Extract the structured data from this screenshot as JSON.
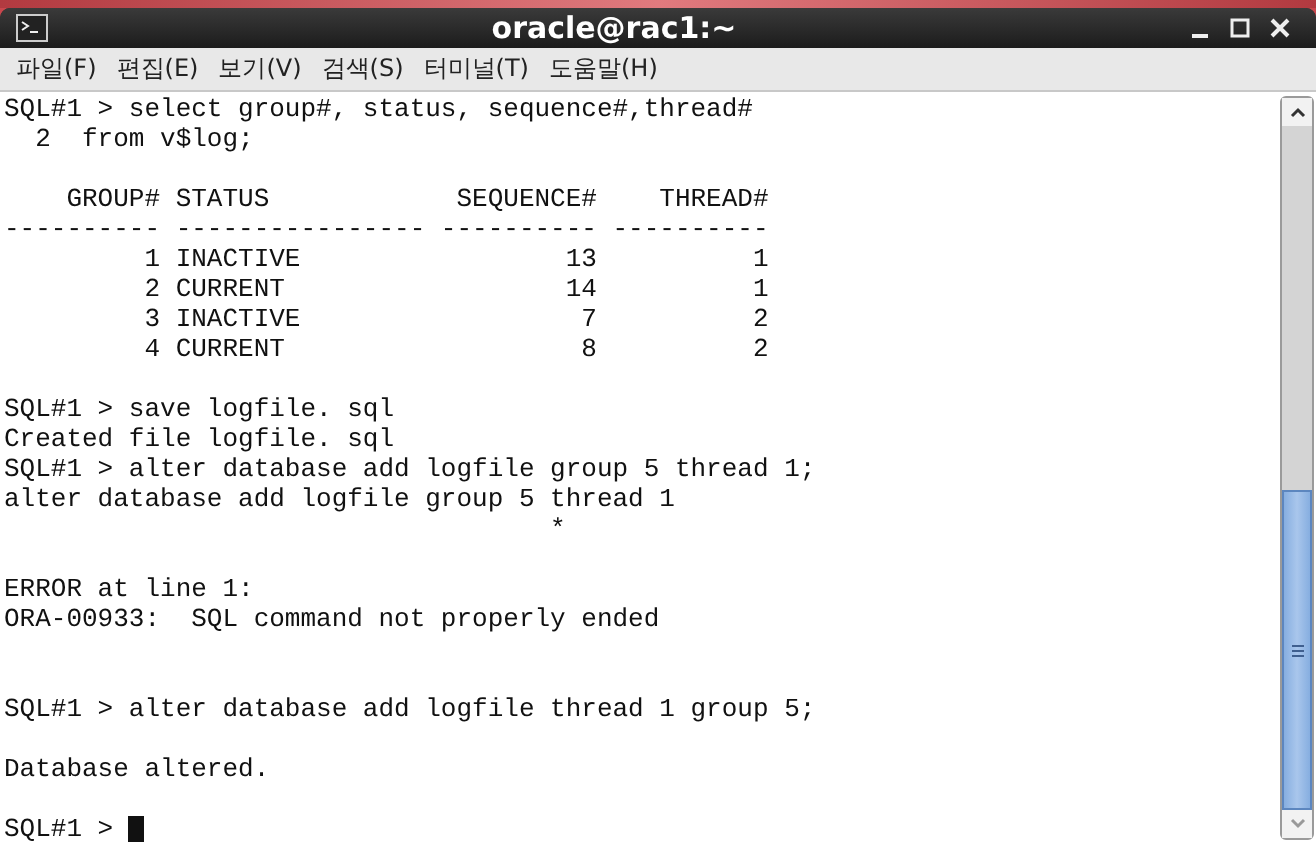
{
  "window": {
    "title": "oracle@rac1:~"
  },
  "menu": [
    "파일(F)",
    "편집(E)",
    "보기(V)",
    "검색(S)",
    "터미널(T)",
    "도움말(H)"
  ],
  "terminal": {
    "lines": [
      {
        "kind": "text",
        "text": "SQL#1 > select group#, status, sequence#,thread#"
      },
      {
        "kind": "text",
        "text": "  2  from v$log;"
      },
      {
        "kind": "blank"
      },
      {
        "kind": "text",
        "text": "    GROUP# STATUS            SEQUENCE#    THREAD#"
      },
      {
        "kind": "text",
        "text": "---------- ---------------- ---------- ----------"
      },
      {
        "kind": "text",
        "text": "         1 INACTIVE                 13          1"
      },
      {
        "kind": "text",
        "text": "         2 CURRENT                  14          1"
      },
      {
        "kind": "text",
        "text": "         3 INACTIVE                  7          2"
      },
      {
        "kind": "text",
        "text": "         4 CURRENT                   8          2"
      },
      {
        "kind": "blank"
      },
      {
        "kind": "text",
        "text": "SQL#1 > save logfile. sql"
      },
      {
        "kind": "text",
        "text": "Created file logfile. sql"
      },
      {
        "kind": "text",
        "text": "SQL#1 > alter database add logfile group 5 thread 1;"
      },
      {
        "kind": "text",
        "text": "alter database add logfile group 5 thread 1"
      },
      {
        "kind": "text",
        "text": "                                   *"
      },
      {
        "kind": "blank"
      },
      {
        "kind": "text",
        "text": "ERROR at line 1:"
      },
      {
        "kind": "text",
        "text": "ORA-00933:  SQL command not properly ended"
      },
      {
        "kind": "blank"
      },
      {
        "kind": "blank"
      },
      {
        "kind": "text",
        "text": "SQL#1 > alter database add logfile thread 1 group 5;"
      },
      {
        "kind": "blank"
      },
      {
        "kind": "text",
        "text": "Database altered."
      },
      {
        "kind": "blank"
      },
      {
        "kind": "prompt",
        "text": "SQL#1 > "
      }
    ]
  }
}
